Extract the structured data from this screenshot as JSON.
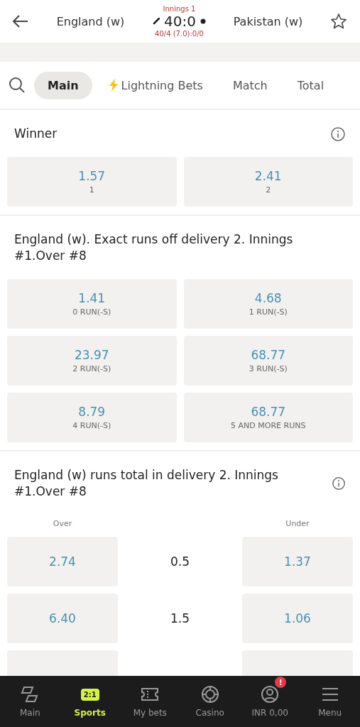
{
  "header": {
    "innings": "Innings 1",
    "home": "England (w)",
    "away": "Pakistan (w)",
    "score": "40:0",
    "detail": "40/4 (7.0):0/0",
    "favorite": false
  },
  "tabs": [
    {
      "label": "Main",
      "selected": true,
      "kind": "plain"
    },
    {
      "label": "Lightning Bets",
      "selected": false,
      "kind": "lightning"
    },
    {
      "label": "Match",
      "selected": false,
      "kind": "plain"
    },
    {
      "label": "Total",
      "selected": false,
      "kind": "plain"
    }
  ],
  "markets": [
    {
      "kind": "grid",
      "title": "Winner",
      "info": true,
      "odds": [
        {
          "value": "1.57",
          "label": "1"
        },
        {
          "value": "2.41",
          "label": "2"
        }
      ]
    },
    {
      "kind": "grid",
      "title": "England (w). Exact runs off delivery 2. Innings #1.Over #8",
      "info": false,
      "odds": [
        {
          "value": "1.41",
          "label": "0 RUN(-S)"
        },
        {
          "value": "4.68",
          "label": "1 RUN(-S)"
        },
        {
          "value": "23.97",
          "label": "2 RUN(-S)"
        },
        {
          "value": "68.77",
          "label": "3 RUN(-S)"
        },
        {
          "value": "8.79",
          "label": "4 RUN(-S)"
        },
        {
          "value": "68.77",
          "label": "5 AND MORE RUNS"
        }
      ]
    },
    {
      "kind": "total",
      "title": "England (w) runs total in delivery 2. Innings #1.Over #8",
      "info": true,
      "over_label": "Over",
      "under_label": "Under",
      "rows": [
        {
          "kind": "full",
          "over": "2.74",
          "line": "0.5",
          "under": "1.37"
        },
        {
          "kind": "full",
          "over": "6.40",
          "line": "1.5",
          "under": "1.06"
        },
        {
          "kind": "cut"
        }
      ]
    }
  ],
  "nav": [
    {
      "label": "Main",
      "selected": false,
      "kind": "main"
    },
    {
      "label": "Sports",
      "selected": true,
      "kind": "sports",
      "badge": "2:1"
    },
    {
      "label": "My bets",
      "selected": false,
      "kind": "ticket"
    },
    {
      "label": "Casino",
      "selected": false,
      "kind": "casino"
    },
    {
      "label": "INR 0,00",
      "selected": false,
      "kind": "account",
      "alert": "!"
    },
    {
      "label": "Menu",
      "selected": false,
      "kind": "menu"
    }
  ]
}
